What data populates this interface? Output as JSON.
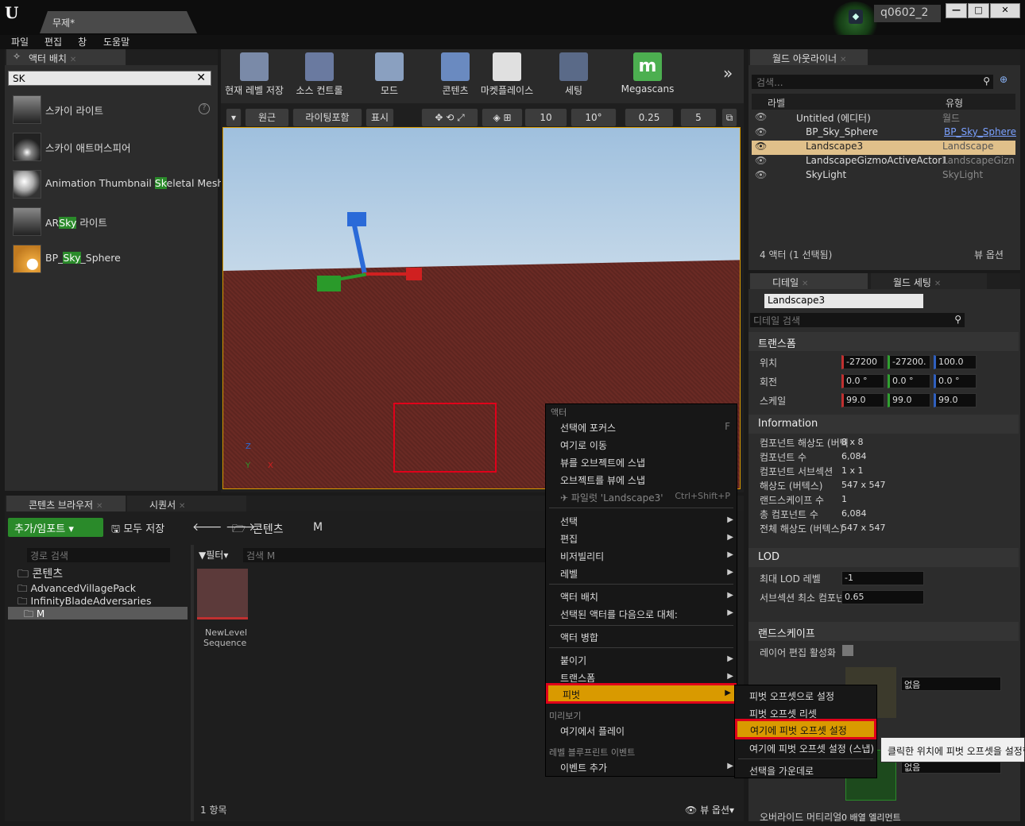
{
  "title_bar": {
    "doc_tab": "무제*",
    "project": "q0602_2",
    "win_min": "—",
    "win_max": "□",
    "win_close": "✕"
  },
  "menu": [
    "파일",
    "편집",
    "창",
    "도움말"
  ],
  "place_actors": {
    "tab": "액터 배치",
    "search_value": "SK",
    "items": [
      {
        "pre": "스카이 라이트",
        "hl": "",
        "post": ""
      },
      {
        "pre": "스카이 애트머스피어",
        "hl": "",
        "post": ""
      },
      {
        "pre": "Animation Thumbnail ",
        "hl": "Sk",
        "post": "eletal Mesh"
      },
      {
        "pre": "AR",
        "hl": "Sky",
        "post": " 라이트"
      },
      {
        "pre": "BP_",
        "hl": "Sky",
        "post": "_Sphere"
      }
    ]
  },
  "toolbar": {
    "items": [
      "현재 레벨 저장",
      "소스 컨트롤",
      "모드",
      "콘텐츠",
      "마켓플레이스",
      "세팅",
      "Megascans"
    ],
    "more": "»"
  },
  "viewport": {
    "perspective": "원근",
    "lighting": "라이팅포함",
    "show": "표시",
    "grid_snap": "10",
    "rot_snap": "10°",
    "scale_snap": "0.25",
    "cam_speed": "5",
    "axis_x": "X",
    "axis_y": "Y",
    "axis_z": "Z"
  },
  "outliner": {
    "tab": "월드 아웃라이너",
    "search_placeholder": "검색...",
    "col_label": "라벨",
    "col_type": "유형",
    "rows": [
      {
        "label": "Untitled (에디터)",
        "type": "월드"
      },
      {
        "label": "BP_Sky_Sphere",
        "type": "BP_Sky_Sphere"
      },
      {
        "label": "Landscape3",
        "type": "Landscape"
      },
      {
        "label": "LandscapeGizmoActiveActor1",
        "type": "LandscapeGizmo"
      },
      {
        "label": "SkyLight",
        "type": "SkyLight"
      }
    ],
    "footer": "4 액터 (1 선택됨)",
    "view_options": "뷰 옵션"
  },
  "details": {
    "tab": "디테일",
    "tab2": "월드 세팅",
    "object_name": "Landscape3",
    "search_placeholder": "디테일 검색",
    "transform_header": "트랜스폼",
    "location_label": "위치",
    "rotation_label": "회전",
    "scale_label": "스케일",
    "location": [
      "-27200",
      "-27200.",
      "100.0"
    ],
    "rotation": [
      "0.0 °",
      "0.0 °",
      "0.0 °"
    ],
    "scale": [
      "99.0",
      "99.0",
      "99.0"
    ],
    "info_header": "Information",
    "info": [
      {
        "k": "컴포넌트 해상도 (버텍",
        "v": "8 x 8"
      },
      {
        "k": "컴포넌트 수",
        "v": "6,084"
      },
      {
        "k": "컴포넌트 서브섹션",
        "v": "1 x 1"
      },
      {
        "k": "해상도 (버텍스)",
        "v": "547 x 547"
      },
      {
        "k": "랜드스케이프 수",
        "v": "1"
      },
      {
        "k": "총 컴포넌트 수",
        "v": "6,084"
      },
      {
        "k": "전체 해상도 (버텍스)",
        "v": "547 x 547"
      }
    ],
    "lod_header": "LOD",
    "lod_max_label": "최대 LOD 레벨",
    "lod_max": "-1",
    "lod_sub_label": "서브섹션 최소 컴포넌",
    "lod_sub": "0.65",
    "landscape_header": "랜드스케이프",
    "layer_edit_label": "레이어 편집 활성화",
    "material_none": "없음",
    "material_none2": "없음",
    "override_label": "오버라이드 머티리얼",
    "override_val": "0 배열 엘리먼트"
  },
  "context_menu": {
    "hdr_actor": "액터",
    "actor_items": [
      "선택에 포커스",
      "여기로 이동",
      "뷰를 오브젝트에 스냅",
      "오브젝트를 뷰에 스냅"
    ],
    "focus_shortcut": "F",
    "pilot": "파일럿 'Landscape3'",
    "pilot_shortcut": "Ctrl+Shift+P",
    "group1": [
      "선택",
      "편집",
      "비저빌리티",
      "레벨"
    ],
    "group2": [
      "액터 배치",
      "선택된 액터를 다음으로 대체:"
    ],
    "merge": "액터 병합",
    "group3": [
      "붙이기",
      "트랜스폼"
    ],
    "pivot": "피벗",
    "hdr_preview": "미리보기",
    "play_here": "여기에서 플레이",
    "hdr_bp": "레벨 블루프린트 이벤트",
    "add_event": "이벤트 추가"
  },
  "pivot_submenu": [
    "피벗 오프셋으로 설정",
    "피벗 오프셋 리셋",
    "여기에 피벗 오프셋 설정",
    "여기에 피벗 오프셋 설정 (스냅)",
    "선택을 가운데로"
  ],
  "tooltip": "클릭한 위치에 피벗 오프셋을 설정합",
  "content_browser": {
    "tab": "콘텐츠 브라우저",
    "tab2": "시퀀서",
    "add_import": "추가/임포트",
    "save_all": "모두 저장",
    "path_root": "콘텐츠",
    "path_sub": "M",
    "path_search_placeholder": "경로 검색",
    "filter": "필터",
    "search_placeholder": "검색 M",
    "tree": [
      "콘텐츠",
      "AdvancedVillagePack",
      "InfinityBladeAdversaries",
      "M"
    ],
    "asset_line1": "NewLevel",
    "asset_line2": "Sequence",
    "count": "1 항목",
    "view_options": "뷰 옵션"
  },
  "colors": {
    "accent_orange": "#d99a00",
    "select_red": "#e0001a",
    "highlight_green": "#2a8a2a"
  }
}
